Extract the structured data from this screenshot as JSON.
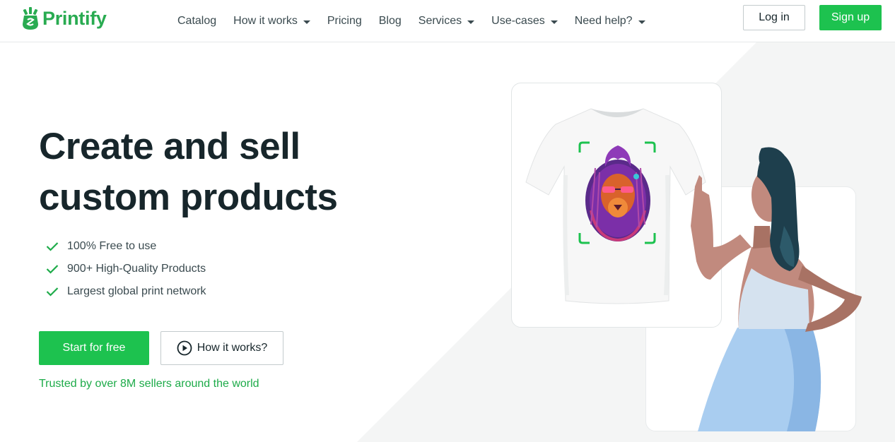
{
  "header": {
    "brand": "Printify",
    "nav": [
      {
        "label": "Catalog",
        "dropdown": false
      },
      {
        "label": "How it works",
        "dropdown": true
      },
      {
        "label": "Pricing",
        "dropdown": false
      },
      {
        "label": "Blog",
        "dropdown": false
      },
      {
        "label": "Services",
        "dropdown": true
      },
      {
        "label": "Use-cases",
        "dropdown": true
      },
      {
        "label": "Need help?",
        "dropdown": true
      }
    ],
    "login_label": "Log in",
    "signup_label": "Sign up"
  },
  "hero": {
    "title_line1": "Create and sell",
    "title_line2": "custom products",
    "features": [
      "100% Free to use",
      "900+ High-Quality Products",
      "Largest global print network"
    ],
    "start_label": "Start for free",
    "how_label": "How it works?",
    "trusted_text": "Trusted by over 8M sellers around the world"
  },
  "colors": {
    "brand_green": "#1dc24f",
    "logo_green": "#29ab51",
    "text_dark": "#17262b"
  }
}
